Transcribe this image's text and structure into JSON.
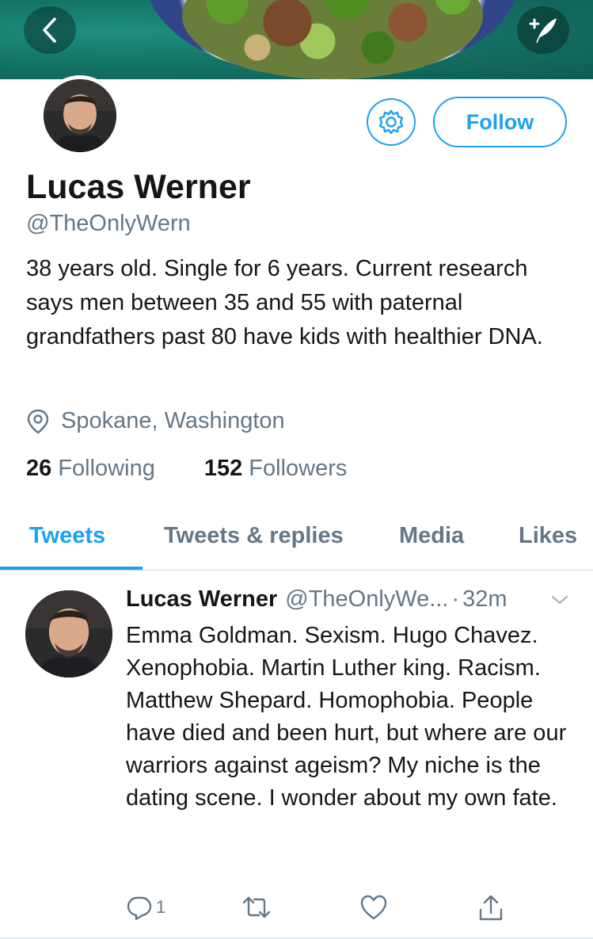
{
  "colors": {
    "accent": "#1da1f2",
    "secondary_text": "#657786",
    "primary_text": "#14171a",
    "divider": "#ccd6dd"
  },
  "header": {
    "back_icon": "chevron-left-icon",
    "compose_icon": "compose-tweet-icon"
  },
  "profile": {
    "display_name": "Lucas Werner",
    "handle": "@TheOnlyWern",
    "bio": "38 years old. Single for 6 years. Current research says men between 35 and 55 with paternal grandfathers past 80 have kids with healthier DNA.",
    "location": "Spokane, Washington",
    "following_count": "26",
    "following_label": "Following",
    "followers_count": "152",
    "followers_label": "Followers",
    "follow_label": "Follow",
    "settings_icon": "gear-icon"
  },
  "tabs": [
    {
      "label": "Tweets",
      "active": true
    },
    {
      "label": "Tweets & replies",
      "active": false
    },
    {
      "label": "Media",
      "active": false
    },
    {
      "label": "Likes",
      "active": false
    }
  ],
  "tweet": {
    "author": "Lucas Werner",
    "handle": "@TheOnlyWe...",
    "separator": "·",
    "time": "32m",
    "text": "Emma Goldman. Sexism. Hugo Chavez. Xenophobia. Martin Luther king. Racism. Matthew Shepard. Homophobia. People have died and been hurt, but where are our warriors against ageism? My niche is the dating scene. I wonder about my own fate.",
    "reply_count": "1",
    "actions": [
      "reply-icon",
      "retweet-icon",
      "like-icon",
      "share-icon"
    ]
  }
}
